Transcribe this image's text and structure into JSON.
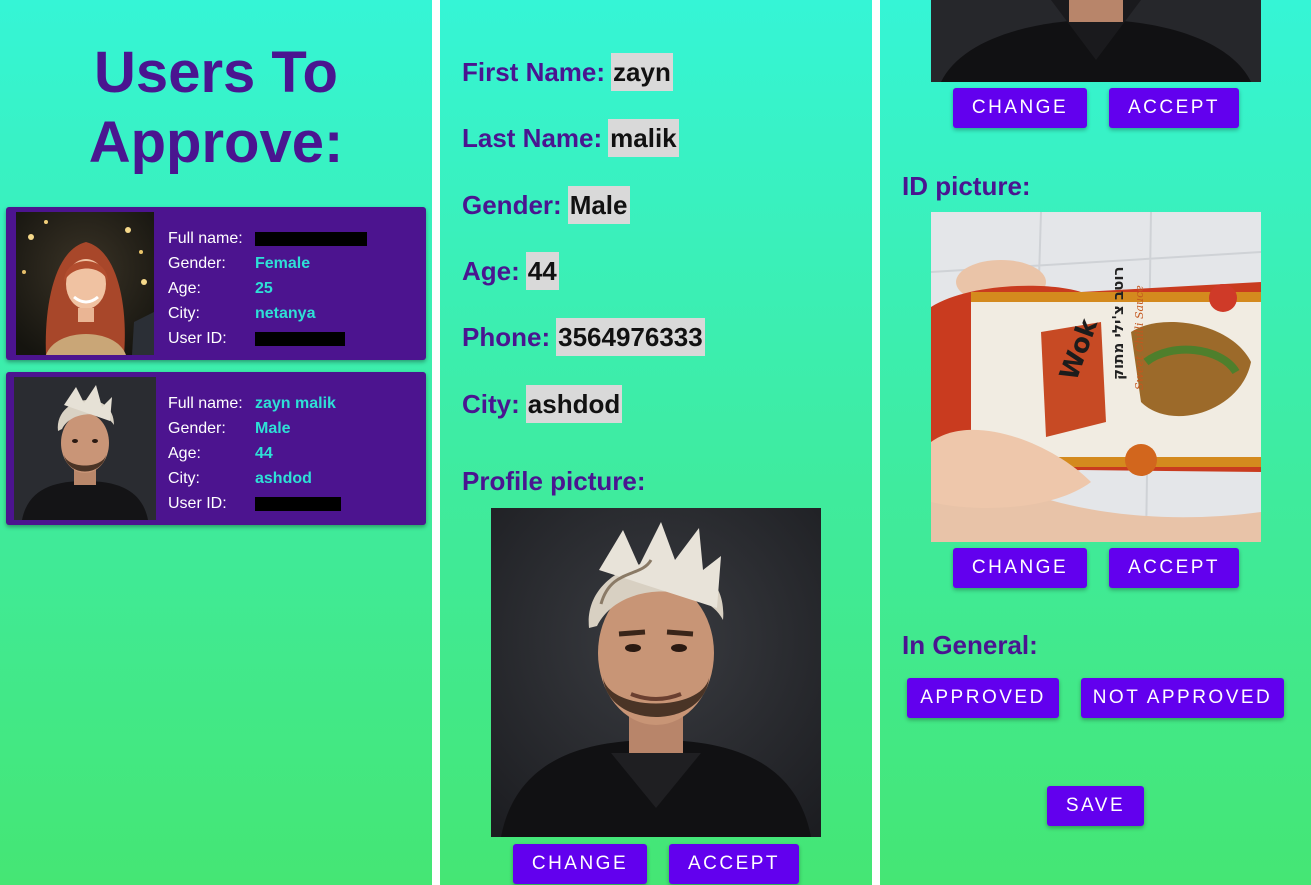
{
  "list_panel": {
    "title": "Users To Approve:",
    "users": [
      {
        "labels": [
          "Full name:",
          "Gender:",
          "Age:",
          "City:",
          "User ID:"
        ],
        "full_name": "",
        "gender": "Female",
        "age": "25",
        "city": "netanya",
        "user_id": ""
      },
      {
        "labels": [
          "Full name:",
          "Gender:",
          "Age:",
          "City:",
          "User ID:"
        ],
        "full_name": "zayn malik",
        "gender": "Male",
        "age": "44",
        "city": "ashdod",
        "user_id": ""
      }
    ]
  },
  "details_panel": {
    "fields": [
      {
        "label": "First Name:",
        "value": "zayn"
      },
      {
        "label": "Last Name:",
        "value": "malik"
      },
      {
        "label": "Gender:",
        "value": "Male"
      },
      {
        "label": "Age:",
        "value": "44"
      },
      {
        "label": "Phone:",
        "value": "3564976333"
      },
      {
        "label": "City:",
        "value": "ashdod"
      }
    ],
    "profile_picture_label": "Profile picture:",
    "change_label": "CHANGE",
    "accept_label": "ACCEPT"
  },
  "pictures_panel": {
    "profile_change_label": "CHANGE",
    "profile_accept_label": "ACCEPT",
    "id_picture_label": "ID picture:",
    "id_change_label": "CHANGE",
    "id_accept_label": "ACCEPT",
    "in_general_label": "In General:",
    "approved_label": "APPROVED",
    "not_approved_label": "NOT APPROVED",
    "save_label": "SAVE",
    "bottle_label_hebrew": "רוטב צ'ילי מתוק",
    "bottle_label_english": "Sweet Chilli Sauce",
    "bottle_brand": "Wok"
  },
  "colors": {
    "gradient_top": "#35f5d6",
    "gradient_bottom": "#45e674",
    "card_background": "#4c148f",
    "heading_text": "#4a1590",
    "value_text": "#2ee0d6",
    "button": "#6200ee",
    "value_highlight": "#d9d9d9"
  }
}
